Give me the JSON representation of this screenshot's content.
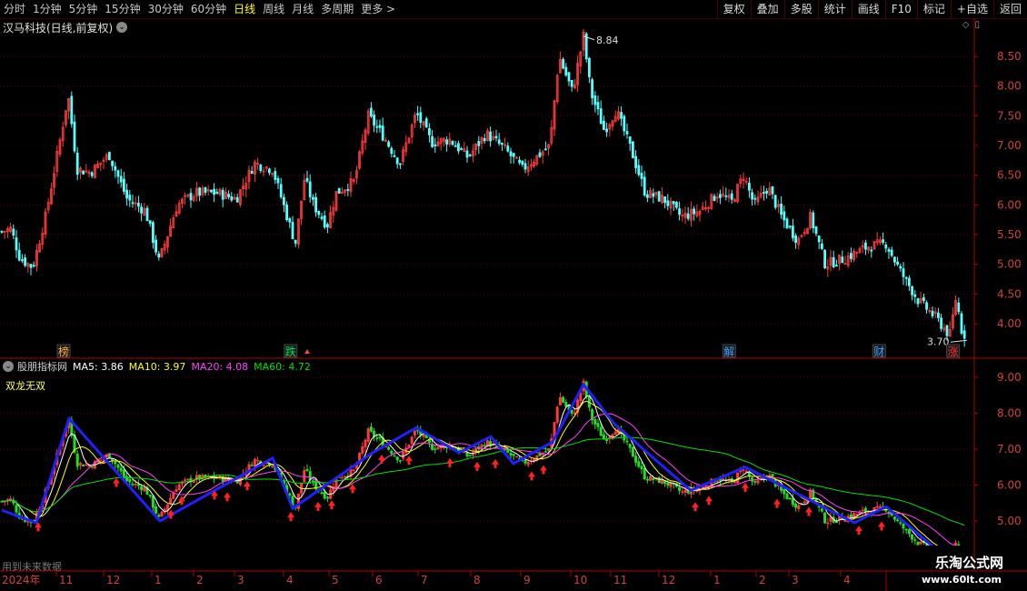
{
  "toolbar": {
    "periods": [
      "分时",
      "1分钟",
      "5分钟",
      "15分钟",
      "30分钟",
      "60分钟",
      "日线",
      "周线",
      "月线",
      "多周期",
      "更多 >"
    ],
    "active_period": "日线",
    "buttons": [
      "复权",
      "叠加",
      "多股",
      "统计",
      "画线",
      "F10",
      "标记",
      "+自选",
      "返回"
    ]
  },
  "main": {
    "title": "汉马科技(日线,前复权)",
    "price_ticks": [
      "8.50",
      "8.00",
      "7.50",
      "7.00",
      "6.50",
      "6.00",
      "5.50",
      "5.00",
      "4.50",
      "4.00"
    ],
    "price_tick_values": [
      8.5,
      8.0,
      7.5,
      7.0,
      6.5,
      6.0,
      5.5,
      5.0,
      4.5,
      4.0
    ],
    "high_label": "8.84",
    "low_label": "3.70",
    "event_tags": [
      {
        "text": "榜",
        "color": "#ffb040",
        "pos": 0.062
      },
      {
        "text": "跌",
        "color": "#00e060",
        "pos": 0.283
      },
      {
        "text": "解",
        "color": "#40a0ff",
        "pos": 0.71
      },
      {
        "text": "财",
        "color": "#40a0ff",
        "pos": 0.856
      },
      {
        "text": "涨",
        "color": "#ff3030",
        "pos": 0.928
      }
    ]
  },
  "indicator": {
    "name": "股朋指标网",
    "ma5": "MA5: 3.86",
    "ma10": "MA10: 3.97",
    "ma20": "MA20: 4.08",
    "ma60": "MA60: 4.72",
    "subtitle": "双龙无双",
    "ticks": [
      "9.00",
      "8.00",
      "7.00",
      "6.00",
      "5.00"
    ],
    "tick_values": [
      9,
      8,
      7,
      6,
      5
    ],
    "note": "用到未来数据"
  },
  "axis": {
    "year_label": "2024年",
    "months": [
      "11",
      "12",
      "1",
      "2",
      "3",
      "4",
      "5",
      "6",
      "7",
      "8",
      "9",
      "10",
      "11",
      "12",
      "1",
      "2",
      "3",
      "4"
    ]
  },
  "watermark": {
    "brand": "乐淘公式网",
    "url": "www.60lt.com"
  },
  "colors": {
    "up": "#ff3a3a",
    "down": "#54ffff",
    "ma5": "#ffffff",
    "ma10": "#ffff00",
    "ma20": "#ff40ff",
    "ma60": "#00e000",
    "zigzag": "#2020ff"
  }
}
